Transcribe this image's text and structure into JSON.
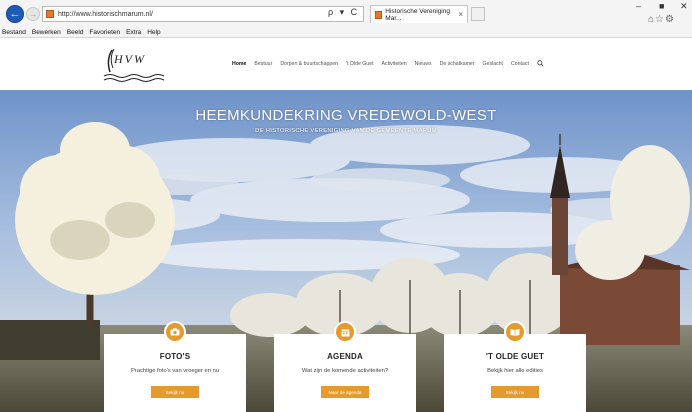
{
  "browser": {
    "url": "http://www.historischmarum.nl/",
    "tab_title": "Historische Vereniging Mar...",
    "tab_close": "×",
    "addr_tools": "ρ ▾ C",
    "win_min": "–",
    "win_max": "■",
    "win_close": "✕",
    "tools_icons": "⌂☆⚙",
    "menu": [
      "Bestand",
      "Bewerken",
      "Beeld",
      "Favorieten",
      "Extra",
      "Help"
    ]
  },
  "site": {
    "logo_text": "HVW",
    "nav": [
      "Home",
      "Bestuur",
      "Dorpen & buurtschappen",
      "'t Olde Guet",
      "Activiteiten",
      "Nieuws",
      "De schatkamer",
      "Geslacht",
      "Contact"
    ],
    "hero_title": "HEEMKUNDEKRING VREDEWOLD-WEST",
    "hero_subtitle": "DE HISTORISCHE VERENIGING VAN DE GEMEENTE MARUM"
  },
  "cards": [
    {
      "icon": "camera-icon",
      "title": "FOTO'S",
      "desc": "Prachtige foto's van vroeger en nu",
      "button": "Bekijk nu"
    },
    {
      "icon": "calendar-icon",
      "title": "AGENDA",
      "desc": "Wat zijn de komende activiteiten?",
      "button": "Naar de agenda"
    },
    {
      "icon": "book-icon",
      "title": "'T OLDE GUET",
      "desc": "Bekijk hier alle edities",
      "button": "Bekijk nu"
    }
  ],
  "colors": {
    "accent": "#e59a2e",
    "ie_blue": "#1e5bb8"
  }
}
